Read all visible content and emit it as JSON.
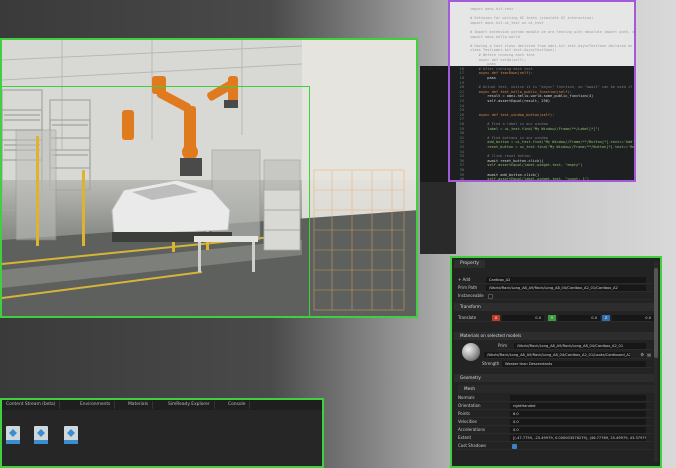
{
  "code_editor": {
    "lines": [
      {
        "n": "",
        "t": "import omni.kit.test",
        "c": "dim"
      },
      {
        "n": "",
        "t": "",
        "c": "dim"
      },
      {
        "n": "",
        "t": "# Extnsion for writing UI tests (simulate UI interaction)",
        "c": "dim"
      },
      {
        "n": "",
        "t": "import omni.kit.ui_test as ui_test",
        "c": "dim"
      },
      {
        "n": "",
        "t": "",
        "c": "dim"
      },
      {
        "n": "",
        "t": "# Import extension python module we are testing with absolute import path, as if we are external user",
        "c": "dim"
      },
      {
        "n": "",
        "t": "import omni.hello.world",
        "c": "dim"
      },
      {
        "n": "",
        "t": "",
        "c": "dim"
      },
      {
        "n": "",
        "t": "# Having a test class dervived from omni.kit.test.AsyncTestCase declared on the root of module",
        "c": "dim"
      },
      {
        "n": "",
        "t": "class Test(omni.kit.test.AsyncTestCase):",
        "c": "dim"
      },
      {
        "n": "",
        "t": "    # Before running each test",
        "c": "dim"
      },
      {
        "n": "",
        "t": "    async def setUp(self):",
        "c": "dim"
      },
      {
        "n": "",
        "t": "        pass",
        "c": "dim"
      },
      {
        "n": "16",
        "t": "    # After running each test",
        "c": "cm"
      },
      {
        "n": "17",
        "t": "    async def tearDown(self):",
        "c": "kw"
      },
      {
        "n": "18",
        "t": "        pass",
        "c": "fn"
      },
      {
        "n": "19",
        "t": "",
        "c": "fn"
      },
      {
        "n": "20",
        "t": "    # Actual test, notice it is \"async\" function, so \"await\" can be used if needed",
        "c": "cm"
      },
      {
        "n": "21",
        "t": "    async def test_hello_public_function(self):",
        "c": "kw"
      },
      {
        "n": "22",
        "t": "        result = omni.hello.world.some_public_function(4)",
        "c": "fn"
      },
      {
        "n": "23",
        "t": "        self.assertEqual(result, 256)",
        "c": "fn"
      },
      {
        "n": "24",
        "t": "",
        "c": "fn"
      },
      {
        "n": "25",
        "t": "",
        "c": "fn"
      },
      {
        "n": "26",
        "t": "    async def test_window_button(self):",
        "c": "kw"
      },
      {
        "n": "27",
        "t": "",
        "c": "fn"
      },
      {
        "n": "28",
        "t": "        # Find a label in our window",
        "c": "cm"
      },
      {
        "n": "29",
        "t": "        label = ui_test.find(\"My Window//Frame/**/Label[*]\")",
        "c": "st"
      },
      {
        "n": "30",
        "t": "",
        "c": "fn"
      },
      {
        "n": "31",
        "t": "        # Find buttons in our window",
        "c": "cm"
      },
      {
        "n": "32",
        "t": "        add_button = ui_test.find(\"My Window//Frame/**/Button[*].text=='Add'\")",
        "c": "st"
      },
      {
        "n": "33",
        "t": "        reset_button = ui_test.find(\"My Window//Frame/**/Button[*].text=='Reset'\")",
        "c": "st"
      },
      {
        "n": "34",
        "t": "",
        "c": "fn"
      },
      {
        "n": "35",
        "t": "        # Click reset button",
        "c": "cm"
      },
      {
        "n": "36",
        "t": "        await reset_button.click()",
        "c": "fn"
      },
      {
        "n": "37",
        "t": "        self.assertEqual(label.widget.text, \"empty\")",
        "c": "st"
      },
      {
        "n": "38",
        "t": "",
        "c": "fn"
      },
      {
        "n": "39",
        "t": "        await add_button.click()",
        "c": "fn"
      },
      {
        "n": "40",
        "t": "        self.assertEqual(label.widget.text, \"count: 1\")",
        "c": "st"
      }
    ]
  },
  "property_panel": {
    "tab": "Property",
    "add_label": "+ Add",
    "name_value": "Cardbox_A2",
    "prim_path_label": "Prim Path",
    "prim_path_value": "/World/Rack/Long_A8_A9/Rack/Long_A8_04/Cardbox_A2_01/Cardbox_A2",
    "instanceable_label": "Instanceable",
    "transform_section": "Transform",
    "translate_label": "Translate",
    "translate_x": "0.0",
    "translate_y": "0.0",
    "translate_z": "0.0",
    "materials_section": "Materials on selected models",
    "prim_label": "Prim",
    "prim_value": "/World/Rack/Long_A8_A9/Rack/Long_A8_04/Cardbox_A2_01",
    "material_value": "/World/Rack/Long_A8_A9/Rack/Long_A8_04/Cardbox_A2_01/Looks/Cardboard_A2",
    "strength_label": "Strength",
    "strength_value": "Weaker than Descendants",
    "geometry_section": "Geometry",
    "mesh_section": "Mesh",
    "mesh_rows": [
      {
        "label": "Normals",
        "value": ""
      },
      {
        "label": "Orientation",
        "value": "rightHanded"
      },
      {
        "label": "Points",
        "value": "6.0"
      },
      {
        "label": "Velocities",
        "value": "0.0"
      },
      {
        "label": "Accelerations",
        "value": "0.0"
      },
      {
        "label": "Extent",
        "value": "[(-47.7759, -25.49979, 0.000003576279), (46.77769, 25.49979, 43.379795)]"
      },
      {
        "label": "Cast Shadows",
        "value": ""
      }
    ]
  },
  "content_browser": {
    "tabs": [
      "Content Stream (beta)",
      "Environments",
      "Materials",
      "SimReady Explorer",
      "Console"
    ]
  }
}
